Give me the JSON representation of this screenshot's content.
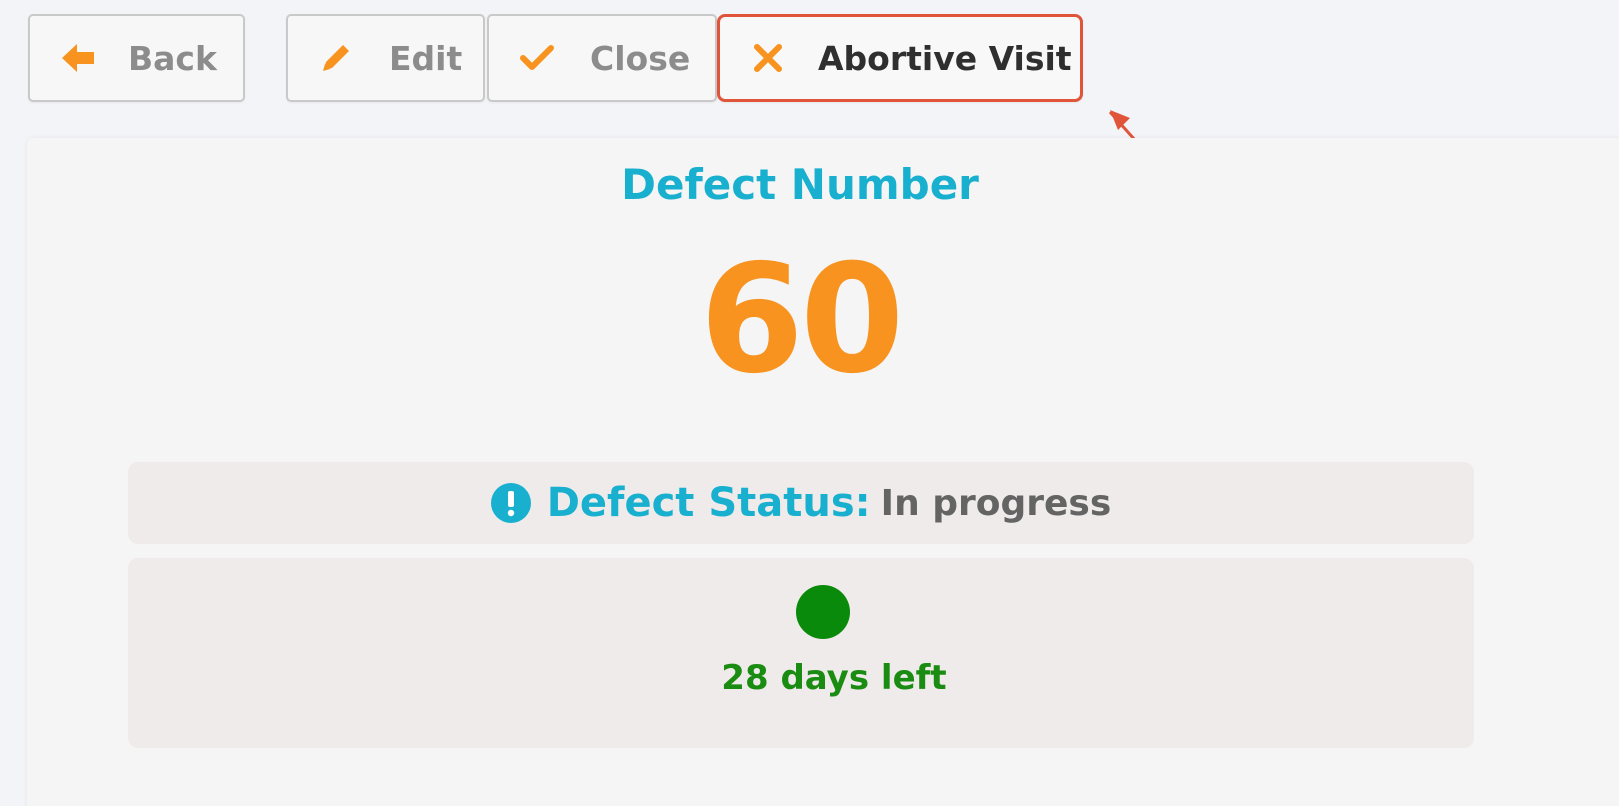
{
  "toolbar": {
    "back_label": "Back",
    "edit_label": "Edit",
    "close_label": "Close",
    "abortive_visit_label": "Abortive Visit"
  },
  "icons": {
    "back": "arrow-left-icon",
    "edit": "pencil-icon",
    "close": "check-icon",
    "abortive_visit": "x-icon",
    "status": "exclamation-circle-icon"
  },
  "defect": {
    "title": "Defect Number",
    "number": "60",
    "status_label": "Defect Status:",
    "status_value": "In progress",
    "sla_text": "28 days left"
  },
  "colors": {
    "accent_orange": "#f7931e",
    "accent_teal": "#19b0cf",
    "highlight_red": "#e0553a",
    "sla_green": "#0a8a0a"
  }
}
